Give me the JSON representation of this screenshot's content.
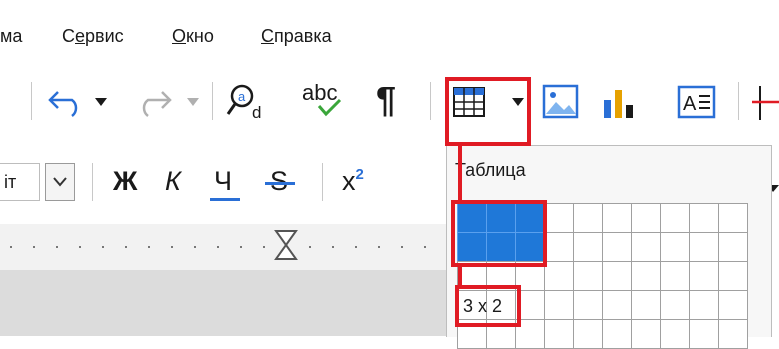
{
  "menu": {
    "items": [
      {
        "label": "ма",
        "underline_index": -1
      },
      {
        "label": "Сервис",
        "underline_index": 1
      },
      {
        "label": "Окно",
        "underline_index": 0
      },
      {
        "label": "Справка",
        "underline_index": 0
      }
    ]
  },
  "toolbar": {
    "icons": [
      "undo-icon",
      "dropdown-arrow-icon",
      "redo-icon",
      "dropdown-arrow-icon",
      "find-replace-icon",
      "spellcheck-icon",
      "formatting-marks-icon",
      "insert-table-icon",
      "dropdown-arrow-icon",
      "insert-image-icon",
      "insert-chart-icon",
      "insert-textbox-icon",
      "field-icon"
    ],
    "spellcheck_label": "abc",
    "pilcrow": "¶"
  },
  "format_bar": {
    "font_fragment": "іт",
    "bold": "Ж",
    "italic": "К",
    "underline": "Ч",
    "strike": "S",
    "superscript": "x",
    "superscript_mark": "2"
  },
  "table_popup": {
    "title": "Таблица",
    "size_label": "3 x 2",
    "selected_cols": 3,
    "selected_rows": 2
  },
  "colors": {
    "highlight_red": "#e01b24",
    "selection_blue": "#1f78d8",
    "icon_blue": "#2a6fd6"
  }
}
